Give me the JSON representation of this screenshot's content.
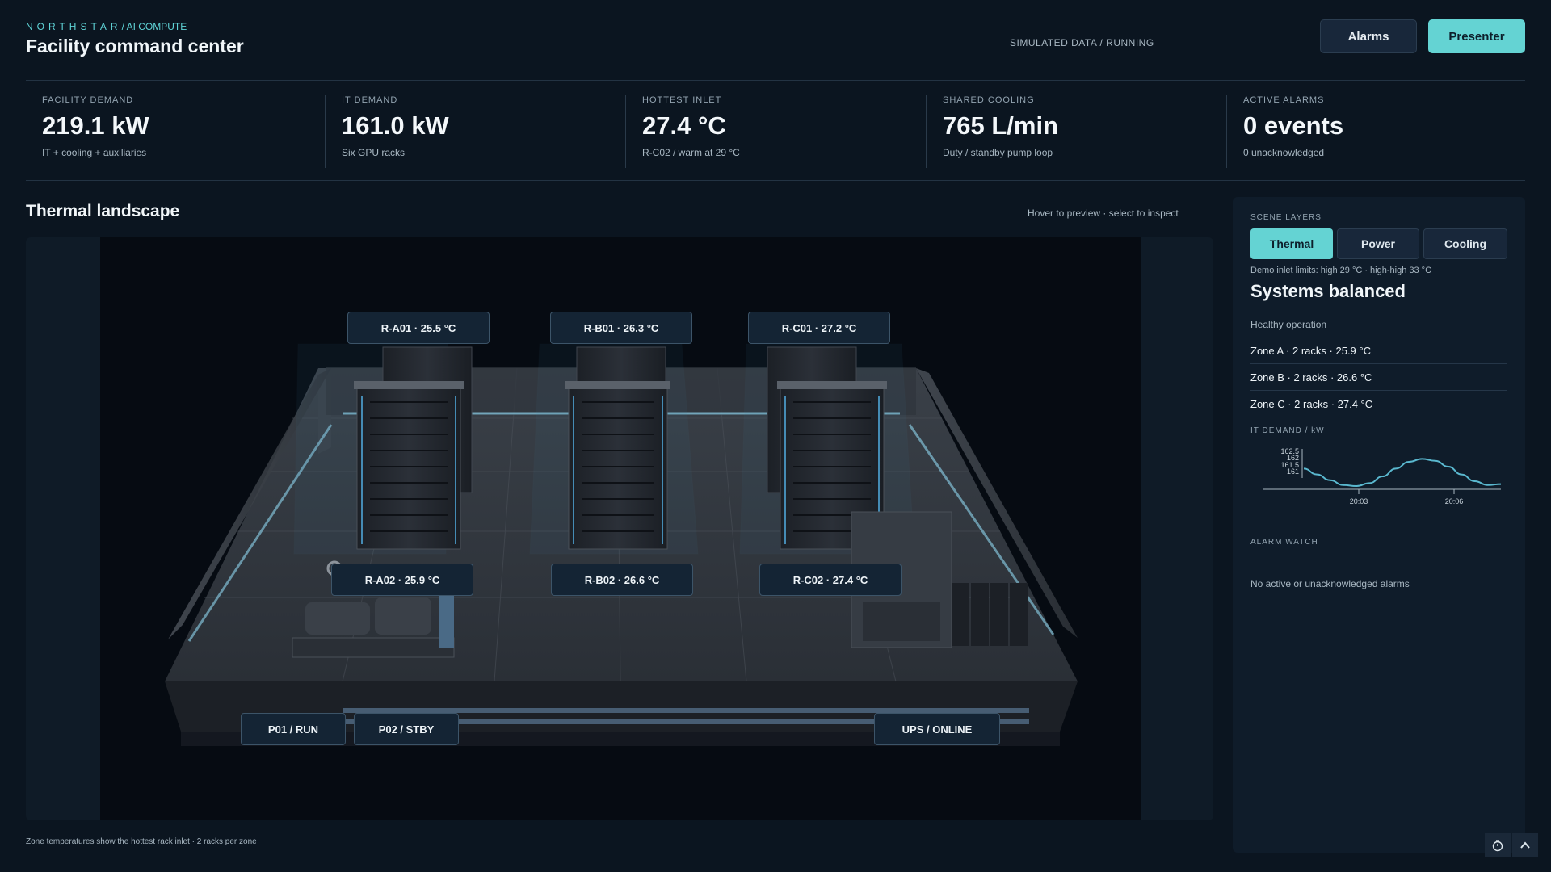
{
  "header": {
    "brand_main": "NORTHSTAR",
    "brand_sub": "/ AI COMPUTE",
    "title": "Facility command center",
    "sim_status": "SIMULATED DATA / RUNNING",
    "alarms_label": "Alarms",
    "presenter_label": "Presenter"
  },
  "kpis": [
    {
      "label": "FACILITY DEMAND",
      "value": "219.1 kW",
      "sub": "IT + cooling + auxiliaries"
    },
    {
      "label": "IT DEMAND",
      "value": "161.0 kW",
      "sub": "Six GPU racks"
    },
    {
      "label": "HOTTEST INLET",
      "value": "27.4 °C",
      "sub": "R-C02 / warm at 29 °C"
    },
    {
      "label": "SHARED COOLING",
      "value": "765 L/min",
      "sub": "Duty / standby pump loop"
    },
    {
      "label": "ACTIVE ALARMS",
      "value": "0 events",
      "sub": "0 unacknowledged"
    }
  ],
  "main": {
    "section_title": "Thermal landscape",
    "hint": "Hover to preview · select to inspect",
    "footnote": "Zone temperatures show the hottest rack inlet · 2 racks per zone"
  },
  "scene": {
    "racks": [
      {
        "label": "R-A01 · 25.5 °C"
      },
      {
        "label": "R-B01 · 26.3 °C"
      },
      {
        "label": "R-C01 · 27.2 °C"
      },
      {
        "label": "R-A02 · 25.9 °C"
      },
      {
        "label": "R-B02 · 26.6 °C"
      },
      {
        "label": "R-C02 · 27.4 °C"
      }
    ],
    "equipment": [
      {
        "label": "P01 / RUN"
      },
      {
        "label": "P02 / STBY"
      },
      {
        "label": "UPS / ONLINE"
      }
    ]
  },
  "panel": {
    "layers_label": "SCENE LAYERS",
    "layers": [
      "Thermal",
      "Power",
      "Cooling"
    ],
    "active_layer": "Thermal",
    "limits": "Demo inlet limits: high 29 °C · high-high 33 °C",
    "status": "Systems balanced",
    "health": "Healthy operation",
    "zones": [
      "Zone A · 2 racks · 25.9 °C",
      "Zone B · 2 racks · 26.6 °C",
      "Zone C · 2 racks · 27.4 °C"
    ],
    "it_label": "IT DEMAND / kW",
    "alarm_label": "ALARM WATCH",
    "no_alarms": "No active or unacknowledged alarms"
  },
  "chart_data": {
    "type": "line",
    "title": "",
    "xlabel": "",
    "ylabel": "",
    "y_ticks": [
      "162.5",
      "162",
      "161.5",
      "161"
    ],
    "x_ticks": [
      "20:03",
      "20:06"
    ],
    "ylim": [
      160.7,
      162.7
    ],
    "series": [
      {
        "values": [
          161.6,
          161.3,
          161.0,
          160.75,
          160.7,
          160.85,
          161.2,
          161.6,
          161.95,
          162.1,
          162.0,
          161.7,
          161.3,
          160.95,
          160.75,
          160.8
        ]
      }
    ]
  },
  "colors": {
    "accent": "#64d3d3",
    "background": "#0b1520",
    "panel": "#0f1c2a",
    "line": "#5ab8cf"
  },
  "icons": {
    "timer": "stopwatch-icon",
    "collapse": "chevron-up-icon"
  }
}
